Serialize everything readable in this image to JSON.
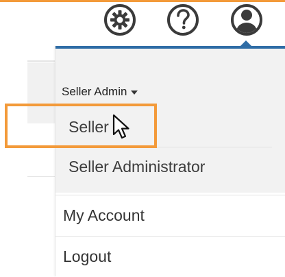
{
  "colors": {
    "accent_orange": "#f39a3a",
    "dropdown_bar_blue": "#2f6da6",
    "icon_dark": "#3b3b3b"
  },
  "toolbar": {
    "settings_icon": "gear-icon",
    "help_icon": "question-circle-icon",
    "account_icon": "user-circle-icon"
  },
  "role_menu": {
    "current_role": "Seller Admin",
    "options": [
      {
        "label": "Seller"
      },
      {
        "label": "Seller Administrator"
      }
    ]
  },
  "account_menu": {
    "items": [
      {
        "label": "My Account"
      },
      {
        "label": "Logout"
      }
    ]
  }
}
